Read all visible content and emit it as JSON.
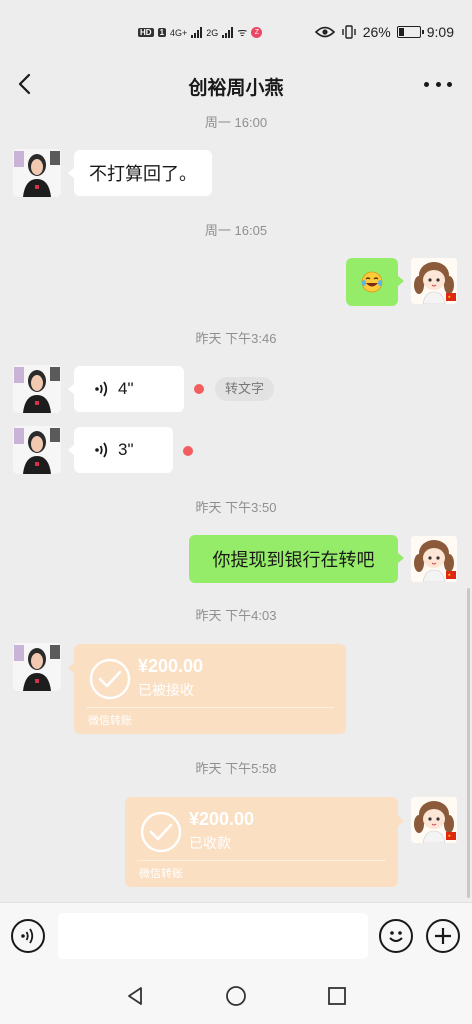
{
  "status_bar": {
    "hd_label": "HD",
    "sim_label": "1",
    "net1": "4G+",
    "net2": "2G",
    "extra_icon": "ᯤ",
    "rec_label": "Z",
    "battery_percent": "26%",
    "battery_level": 0.26,
    "clock": "9:09"
  },
  "header": {
    "title": "创裕周小燕"
  },
  "messages": [
    {
      "id": "t1",
      "type": "time",
      "text": "周一 16:00"
    },
    {
      "id": "m1",
      "type": "text",
      "from": "her",
      "text": "不打算回了。"
    },
    {
      "id": "t2",
      "type": "time",
      "text": "周一 16:05"
    },
    {
      "id": "m2",
      "type": "emoji",
      "from": "me",
      "icon": "laughing-tears-emoji-icon"
    },
    {
      "id": "t3",
      "type": "time",
      "text": "昨天 下午3:46"
    },
    {
      "id": "m3",
      "type": "voice",
      "from": "her",
      "duration": "4\"",
      "to_text_label": "转文字"
    },
    {
      "id": "m4",
      "type": "voice",
      "from": "her",
      "duration": "3\""
    },
    {
      "id": "t4",
      "type": "time",
      "text": "昨天 下午3:50"
    },
    {
      "id": "m5",
      "type": "text",
      "from": "me",
      "text": "你提现到银行在转吧"
    },
    {
      "id": "t5",
      "type": "time",
      "text": "昨天 下午4:03"
    },
    {
      "id": "m6",
      "type": "transfer",
      "from": "her",
      "amount": "¥200.00",
      "status": "已被接收",
      "source": "微信转账"
    },
    {
      "id": "t6",
      "type": "time",
      "text": "昨天 下午5:58"
    },
    {
      "id": "m7",
      "type": "transfer",
      "from": "me",
      "amount": "¥200.00",
      "status": "已收款",
      "source": "微信转账"
    }
  ],
  "input_bar": {
    "value": "",
    "placeholder": "",
    "left_icon": "voice-mode-icon",
    "right_icons": [
      "emoji-icon",
      "add-icon"
    ]
  },
  "nav": [
    "back-triangle-icon",
    "home-circle-icon",
    "recents-square-icon"
  ],
  "colors": {
    "background": "#ededed",
    "my_bubble": "#95ec69",
    "their_bubble": "#ffffff",
    "transfer_done": "#fbdfc3",
    "unread_dot": "#f25e5e"
  }
}
